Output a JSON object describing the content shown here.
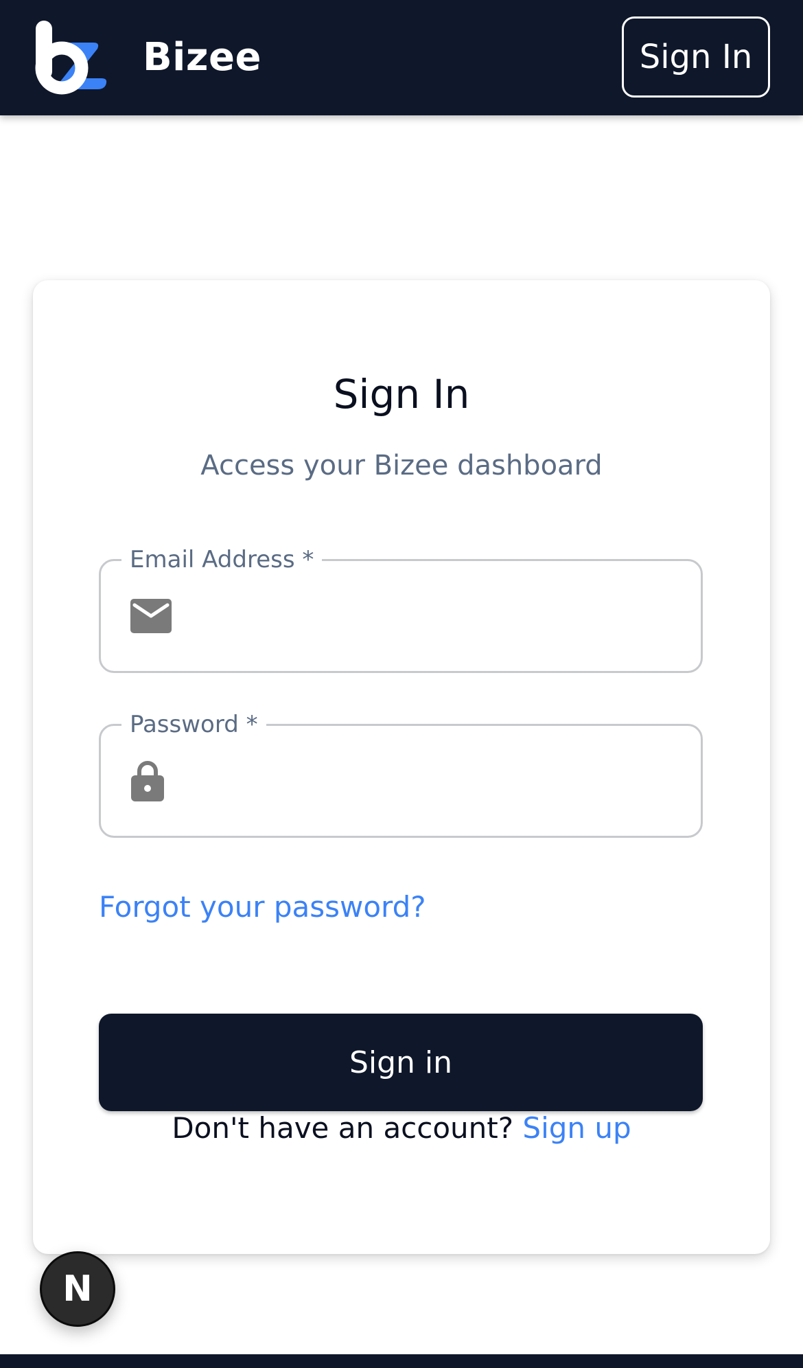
{
  "header": {
    "brand_name": "Bizee",
    "sign_in_label": "Sign In"
  },
  "card": {
    "title": "Sign In",
    "subtitle": "Access your Bizee dashboard"
  },
  "fields": {
    "email": {
      "label": "Email Address *",
      "value": "",
      "icon": "mail-icon"
    },
    "password": {
      "label": "Password *",
      "value": "",
      "icon": "lock-icon"
    }
  },
  "links": {
    "forgot_password": "Forgot your password?"
  },
  "actions": {
    "primary_sign_in": "Sign in"
  },
  "footer": {
    "prompt": "Don't have an account?",
    "sign_up": "Sign up"
  },
  "dev_badge": {
    "label": "N"
  },
  "colors": {
    "header_bg": "#0f172a",
    "link_blue": "#3b82f6",
    "muted_text": "#5a6b84",
    "logo_blue": "#3b82f6"
  }
}
